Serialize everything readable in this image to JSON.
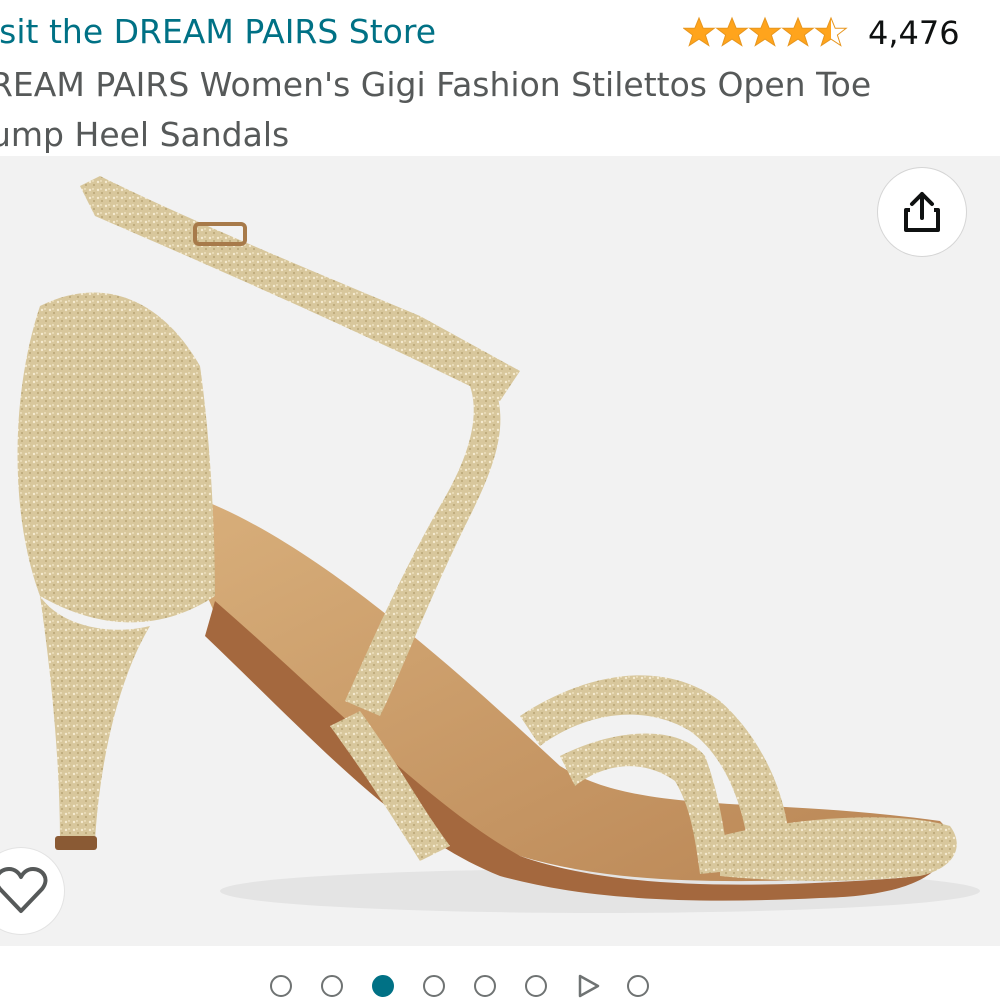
{
  "header": {
    "store_link": "isit the DREAM PAIRS Store",
    "rating_count": "4,476",
    "title_line1": "REAM PAIRS Women's Gigi Fashion Stilettos Open Toe",
    "title_line2": "ump Heel Sandals"
  },
  "rating": {
    "stars": 4.5,
    "max": 5
  },
  "colors": {
    "link": "#007185",
    "star": "#FFA41C",
    "active_dot": "#007185"
  },
  "product_image": {
    "subject": "gold glitter strappy stiletto sandal"
  },
  "icons": {
    "share": "share-icon",
    "wishlist": "heart-icon",
    "video": "play-icon"
  },
  "gallery": {
    "count": 8,
    "active_index": 2,
    "video_index": 6
  }
}
